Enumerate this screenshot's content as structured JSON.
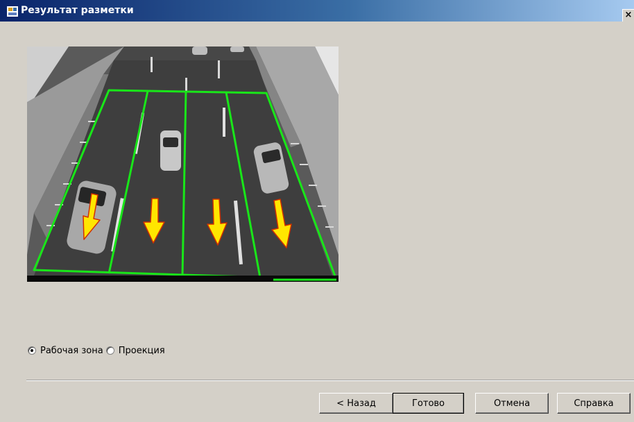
{
  "window": {
    "title": "Результат разметки",
    "close_glyph": "×",
    "icon": "app-window-icon"
  },
  "preview": {
    "description_icon": "road-camera-frame",
    "zone_outline_color": "#19e619",
    "arrow_color": "#ffe600",
    "arrow_outline_color": "#d03000",
    "lanes": 4
  },
  "view_mode": {
    "options": [
      {
        "label": "Рабочая зона",
        "checked": true
      },
      {
        "label": "Проекция",
        "checked": false
      }
    ]
  },
  "buttons": {
    "back": "< Назад",
    "done": "Готово",
    "cancel": "Отмена",
    "help": "Справка"
  }
}
